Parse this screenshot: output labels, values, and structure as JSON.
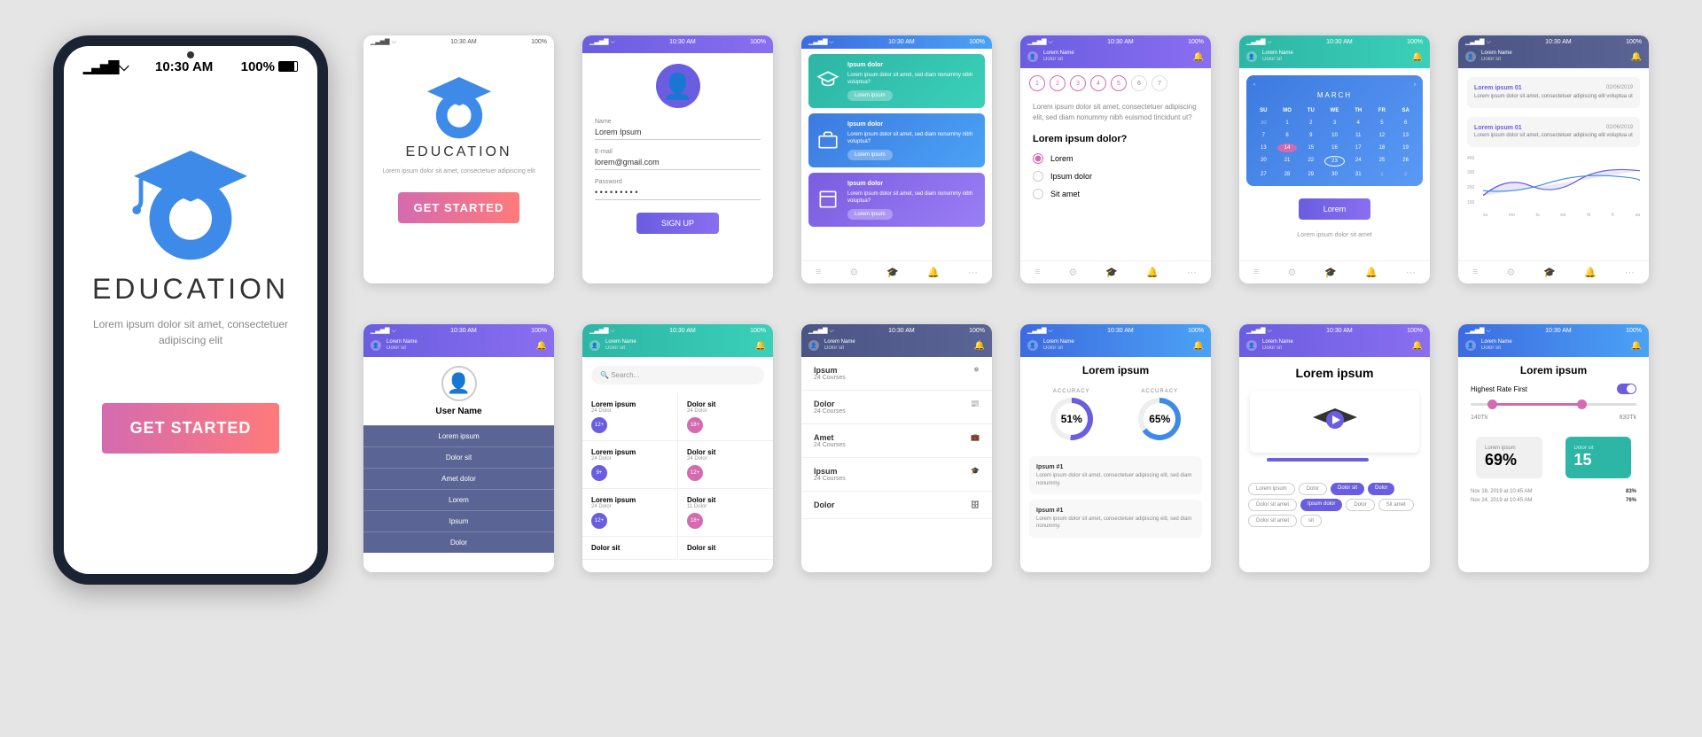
{
  "status": {
    "signal": "▁▃▅▇",
    "wifi": "⌵",
    "time": "10:30 AM",
    "battery": "100%"
  },
  "app": {
    "title": "EDUCATION",
    "tagline": "Lorem ipsum dolor sit amet, consectetuer adipiscing elit",
    "cta": "GET STARTED"
  },
  "signup": {
    "name_lbl": "Name",
    "name_val": "Lorem Ipsum",
    "email_lbl": "E-mail",
    "email_val": "lorem@gmail.com",
    "pass_lbl": "Password",
    "pass_val": "• • • • • • • • •",
    "btn": "SIGN UP"
  },
  "cards": [
    {
      "h": "Ipsum dolor",
      "t": "Lorem ipsum dolor sit amet, sed diam nonummy nibh voluptua?",
      "btn": "Lorem ipsum"
    },
    {
      "h": "Ipsum dolor",
      "t": "Lorem ipsum dolor sit amet, sed diam nonummy nibh voluptua?",
      "btn": "Lorem ipsum"
    },
    {
      "h": "Ipsum dolor",
      "t": "Lorem ipsum dolor sit amet, sed diam nonummy nibh voluptua?",
      "btn": "Lorem ipsum"
    }
  ],
  "quiz": {
    "days": [
      "1",
      "2",
      "3",
      "4",
      "5",
      "6",
      "7"
    ],
    "hint": "Lorem ipsum dolor sit amet, consectetuer adipiscing elit, sed diam nonummy nibh euismod tincidunt ut?",
    "q": "Lorem ipsum dolor?",
    "opts": [
      "Lorem",
      "Ipsum dolor",
      "Sit amet"
    ]
  },
  "calendar": {
    "month": "MARCH",
    "wd": [
      "SU",
      "MO",
      "TU",
      "WE",
      "TH",
      "FR",
      "SA"
    ],
    "btn": "Lorem",
    "foot": "Lorem ipsum dolor sit amet"
  },
  "notes": [
    {
      "t": "Lorem ipsum 01",
      "d": "02/06/2019",
      "b": "Lorem ipsum dolor sit amet, consectetuer adipiscing elit voluptua ut"
    },
    {
      "t": "Lorem ipsum 01",
      "d": "02/06/2019",
      "b": "Lorem ipsum dolor sit amet, consectetuer adipiscing elit voluptua ut"
    }
  ],
  "chart": {
    "y": [
      "400",
      "300",
      "200",
      "100"
    ],
    "x": [
      "su",
      "mo",
      "tu",
      "we",
      "th",
      "fr",
      "sa"
    ]
  },
  "user": {
    "name": "Lorem Name",
    "sub": "Dolor sit"
  },
  "profile": {
    "name": "User Name",
    "items": [
      "Lorem ipsum",
      "Dolor sit",
      "Amet dolor",
      "Lorem",
      "Ipsum",
      "Dolor"
    ]
  },
  "search": {
    "ph": "Search..."
  },
  "catalog": [
    {
      "t": "Lorem ipsum",
      "s": "24 Dolor",
      "b": "12+",
      "c": "#6a5de0"
    },
    {
      "t": "Dolor sit",
      "s": "24 Dolor",
      "b": "18+",
      "c": "#d46bb0"
    },
    {
      "t": "Lorem ipsum",
      "s": "24 Dolor",
      "b": "9+",
      "c": "#6a5de0"
    },
    {
      "t": "Dolor sit",
      "s": "24 Dolor",
      "b": "12+",
      "c": "#d46bb0"
    },
    {
      "t": "Lorem ipsum",
      "s": "24 Dolor",
      "b": "12+",
      "c": "#6a5de0"
    },
    {
      "t": "Dolor sit",
      "s": "11 Dolor",
      "b": "18+",
      "c": "#d46bb0"
    },
    {
      "t": "Dolor sit",
      "s": "",
      "b": "",
      "c": ""
    },
    {
      "t": "Dolor sit",
      "s": "",
      "b": "",
      "c": ""
    }
  ],
  "courses": [
    {
      "t": "Ipsum",
      "s": "24 Courses"
    },
    {
      "t": "Dolor",
      "s": "24 Courses"
    },
    {
      "t": "Amet",
      "s": "24 Courses"
    },
    {
      "t": "Ipsum",
      "s": "24 Courses"
    },
    {
      "t": "Dolor",
      "s": ""
    }
  ],
  "accuracy": {
    "title": "Lorem ipsum",
    "lbl": "ACCURACY",
    "a": "51%",
    "b": "65%",
    "items": [
      {
        "t": "Ipsum #1",
        "b": "Lorem ipsum dolor sit amet, consectetuer adipiscing elit, sed diam nonummy."
      },
      {
        "t": "Ipsum #1",
        "b": "Lorem ipsum dolor sit amet, consectetuer adipiscing elit, sed diam nonummy."
      }
    ]
  },
  "video": {
    "title": "Lorem ipsum",
    "pills": [
      "Lorem ipsum",
      "Dolor",
      "Dolor sit",
      "Dolor",
      "Dolor sit amet",
      "Ipsum dolor",
      "Dolor",
      "Sit amet",
      "Dolor sit amet",
      "sit"
    ]
  },
  "filter": {
    "title": "Lorem ipsum",
    "sort": "Highest Rate First",
    "min": "140Tk",
    "max": "830Tk",
    "stat_l": "Lorem ipsum",
    "stat_lv": "69%",
    "stat_r": "Dolor sit",
    "stat_rv": "15",
    "h1": "Nov 18, 2019 at 10:45 AM",
    "h1v": "83%",
    "h2": "Nov 24, 2019 at 10:45 AM",
    "h2v": "76%"
  }
}
